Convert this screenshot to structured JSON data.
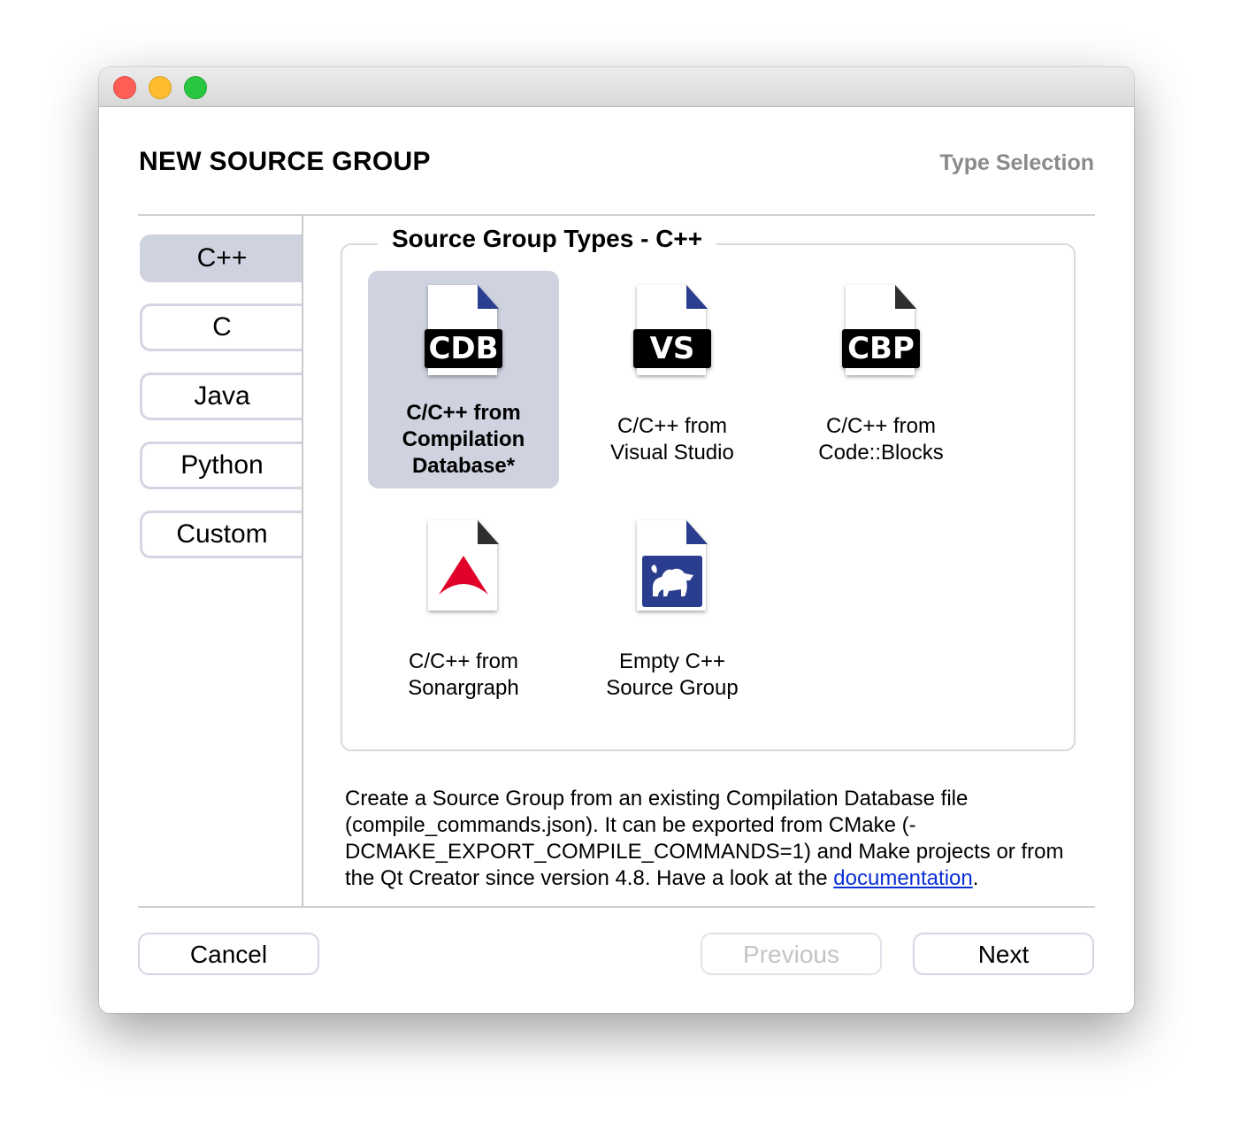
{
  "window": {
    "traffic_lights": [
      "close",
      "minimize",
      "zoom"
    ]
  },
  "header": {
    "title": "NEW SOURCE GROUP",
    "step": "Type Selection"
  },
  "sidebar": {
    "items": [
      {
        "label": "C++",
        "selected": true
      },
      {
        "label": "C",
        "selected": false
      },
      {
        "label": "Java",
        "selected": false
      },
      {
        "label": "Python",
        "selected": false
      },
      {
        "label": "Custom",
        "selected": false
      }
    ]
  },
  "group": {
    "title": "Source Group Types - C++",
    "types": [
      {
        "line1": "C/C++ from",
        "line2": "Compilation",
        "line3": "Database*",
        "badge": "CDB",
        "icon": "cdb-file-icon",
        "selected": true
      },
      {
        "line1": "C/C++ from",
        "line2": "Visual Studio",
        "badge": "VS",
        "icon": "vs-file-icon",
        "selected": false
      },
      {
        "line1": "C/C++ from",
        "line2": "Code::Blocks",
        "badge": "CBP",
        "icon": "cbp-file-icon",
        "selected": false
      },
      {
        "line1": "C/C++ from",
        "line2": "Sonargraph",
        "icon": "sonargraph-file-icon",
        "selected": false
      },
      {
        "line1": "Empty C++",
        "line2": "Source Group",
        "icon": "sourcetrail-file-icon",
        "selected": false
      }
    ]
  },
  "description": {
    "text": "Create a Source Group from an existing Compilation Database file (compile_commands.json). It can be exported from CMake (-DCMAKE_EXPORT_COMPILE_COMMANDS=1) and Make projects or from the Qt Creator since version 4.8. Have a look at the ",
    "link": "documentation",
    "end": "."
  },
  "buttons": {
    "cancel": "Cancel",
    "previous": "Previous",
    "next": "Next"
  },
  "colors": {
    "selection": "#cfd2df",
    "link": "#0a2fd6",
    "sonargraph_red": "#e0002a",
    "sourcetrail_blue": "#2b3d8f"
  }
}
